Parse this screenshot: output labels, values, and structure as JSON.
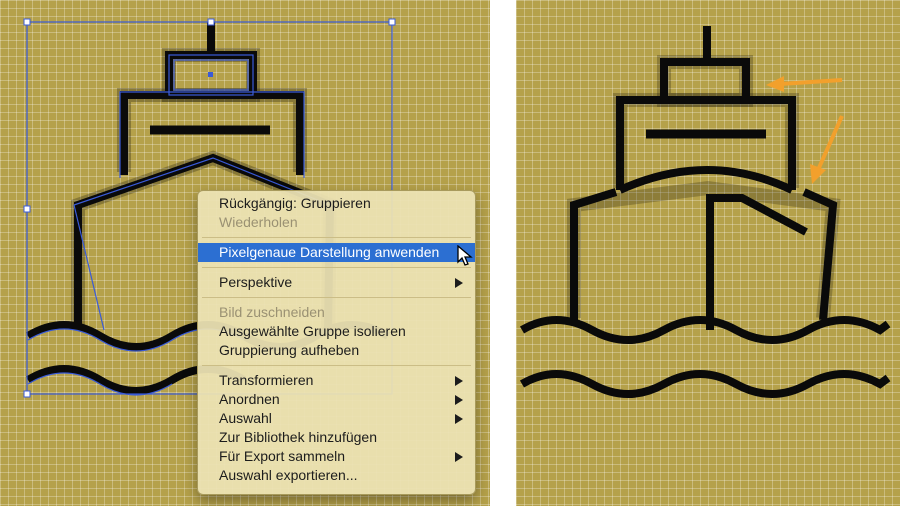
{
  "context_menu": {
    "groups": [
      [
        {
          "label": "Rückgängig: Gruppieren",
          "disabled": false,
          "submenu": false
        },
        {
          "label": "Wiederholen",
          "disabled": true,
          "submenu": false
        }
      ],
      [
        {
          "label": "Pixelgenaue Darstellung anwenden",
          "disabled": false,
          "submenu": false,
          "highlighted": true
        }
      ],
      [
        {
          "label": "Perspektive",
          "disabled": false,
          "submenu": true
        }
      ],
      [
        {
          "label": "Bild zuschneiden",
          "disabled": true,
          "submenu": false
        },
        {
          "label": "Ausgewählte Gruppe isolieren",
          "disabled": false,
          "submenu": false
        },
        {
          "label": "Gruppierung aufheben",
          "disabled": false,
          "submenu": false
        }
      ],
      [
        {
          "label": "Transformieren",
          "disabled": false,
          "submenu": true
        },
        {
          "label": "Anordnen",
          "disabled": false,
          "submenu": true
        },
        {
          "label": "Auswahl",
          "disabled": false,
          "submenu": true
        },
        {
          "label": "Zur Bibliothek hinzufügen",
          "disabled": false,
          "submenu": false
        },
        {
          "label": "Für Export sammeln",
          "disabled": false,
          "submenu": true
        },
        {
          "label": "Auswahl exportieren...",
          "disabled": false,
          "submenu": false
        }
      ]
    ]
  },
  "icons": {
    "left_artwork": "ship-icon",
    "right_artwork": "ship-icon",
    "annotation_arrows": "arrow-icon",
    "pointer": "mouse-pointer-icon"
  },
  "colors": {
    "canvas": "#b5a14a",
    "artwork": "#0a0a0a",
    "selection": "#3a5bd8",
    "menu_highlight": "#2c6fd2",
    "annotation_arrow": "#f2a02c"
  }
}
